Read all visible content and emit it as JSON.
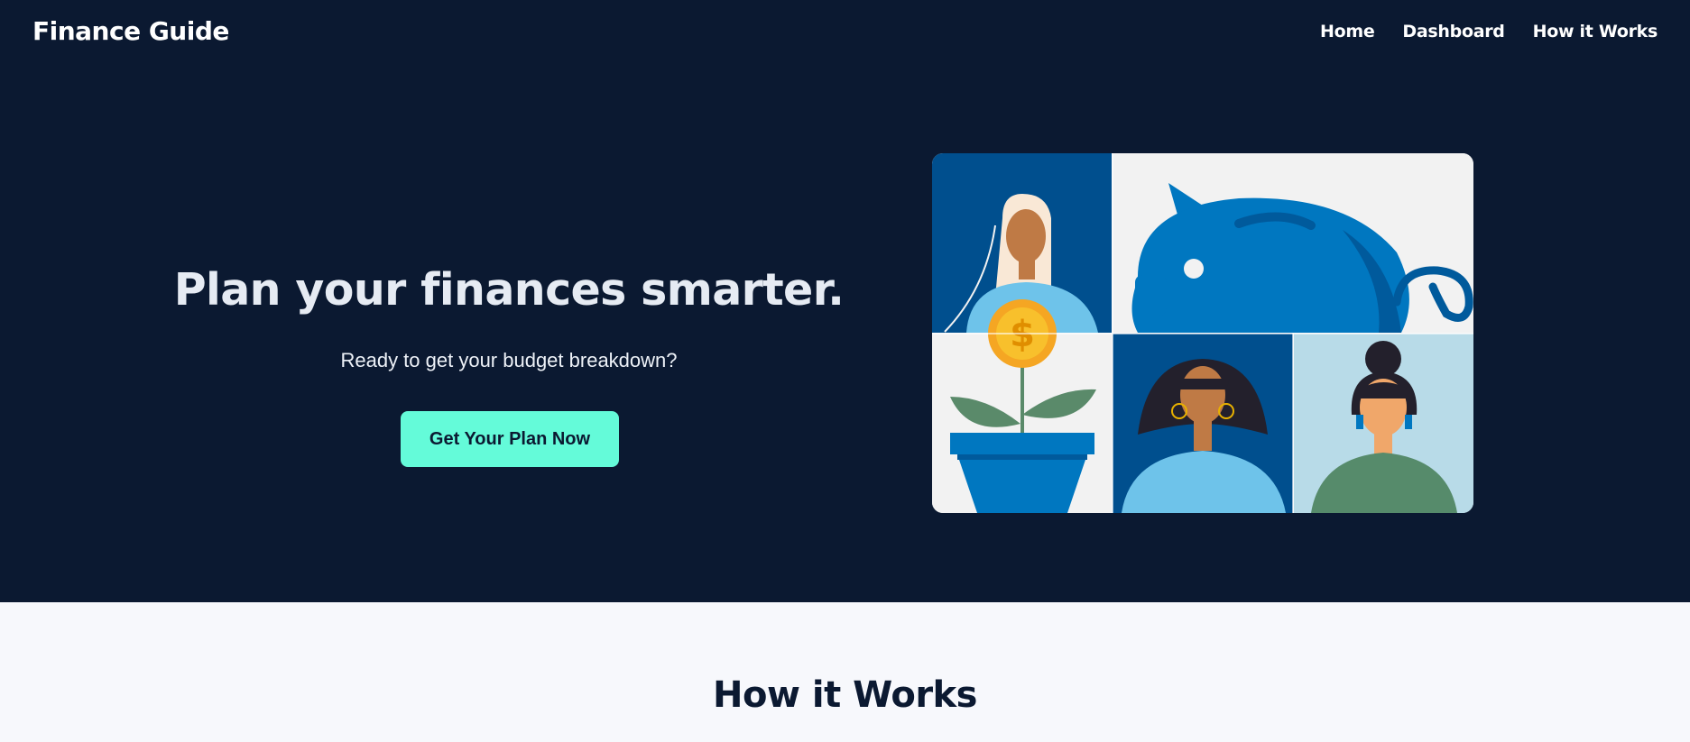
{
  "nav": {
    "brand": "Finance Guide",
    "links": [
      "Home",
      "Dashboard",
      "How it Works"
    ]
  },
  "hero": {
    "title": "Plan your finances smarter.",
    "subtitle": "Ready to get your budget breakdown?",
    "cta_label": "Get Your Plan Now",
    "illustration": {
      "name": "finance-collage-illustration",
      "coin_symbol": "$"
    }
  },
  "how_it_works": {
    "title": "How it Works"
  },
  "colors": {
    "hero_bg": "#0b1931",
    "accent": "#64fbd9",
    "page_bg": "#f7f8fc",
    "illustration_blue": "#0077c0"
  }
}
